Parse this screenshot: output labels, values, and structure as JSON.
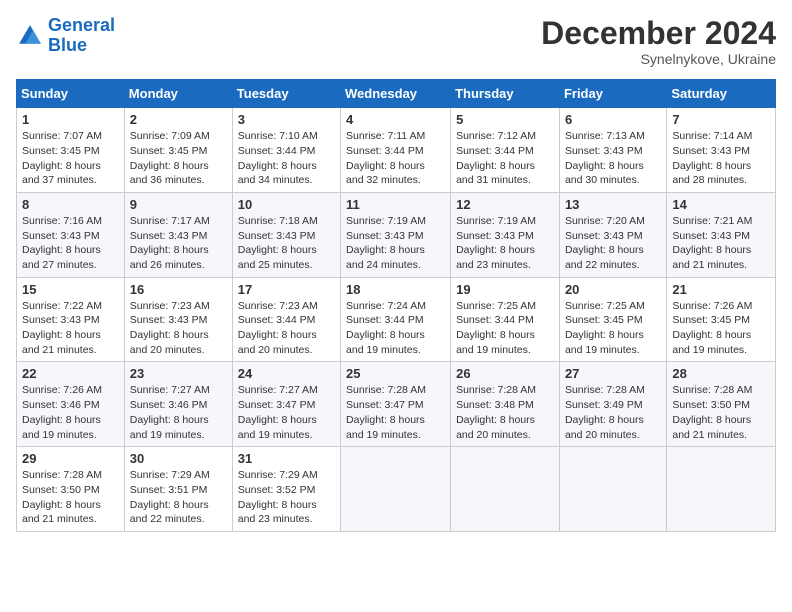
{
  "logo": {
    "line1": "General",
    "line2": "Blue"
  },
  "title": "December 2024",
  "subtitle": "Synelnykove, Ukraine",
  "days_header": [
    "Sunday",
    "Monday",
    "Tuesday",
    "Wednesday",
    "Thursday",
    "Friday",
    "Saturday"
  ],
  "weeks": [
    [
      {
        "day": "1",
        "rise": "Sunrise: 7:07 AM",
        "set": "Sunset: 3:45 PM",
        "daylight": "Daylight: 8 hours and 37 minutes."
      },
      {
        "day": "2",
        "rise": "Sunrise: 7:09 AM",
        "set": "Sunset: 3:45 PM",
        "daylight": "Daylight: 8 hours and 36 minutes."
      },
      {
        "day": "3",
        "rise": "Sunrise: 7:10 AM",
        "set": "Sunset: 3:44 PM",
        "daylight": "Daylight: 8 hours and 34 minutes."
      },
      {
        "day": "4",
        "rise": "Sunrise: 7:11 AM",
        "set": "Sunset: 3:44 PM",
        "daylight": "Daylight: 8 hours and 32 minutes."
      },
      {
        "day": "5",
        "rise": "Sunrise: 7:12 AM",
        "set": "Sunset: 3:44 PM",
        "daylight": "Daylight: 8 hours and 31 minutes."
      },
      {
        "day": "6",
        "rise": "Sunrise: 7:13 AM",
        "set": "Sunset: 3:43 PM",
        "daylight": "Daylight: 8 hours and 30 minutes."
      },
      {
        "day": "7",
        "rise": "Sunrise: 7:14 AM",
        "set": "Sunset: 3:43 PM",
        "daylight": "Daylight: 8 hours and 28 minutes."
      }
    ],
    [
      {
        "day": "8",
        "rise": "Sunrise: 7:16 AM",
        "set": "Sunset: 3:43 PM",
        "daylight": "Daylight: 8 hours and 27 minutes."
      },
      {
        "day": "9",
        "rise": "Sunrise: 7:17 AM",
        "set": "Sunset: 3:43 PM",
        "daylight": "Daylight: 8 hours and 26 minutes."
      },
      {
        "day": "10",
        "rise": "Sunrise: 7:18 AM",
        "set": "Sunset: 3:43 PM",
        "daylight": "Daylight: 8 hours and 25 minutes."
      },
      {
        "day": "11",
        "rise": "Sunrise: 7:19 AM",
        "set": "Sunset: 3:43 PM",
        "daylight": "Daylight: 8 hours and 24 minutes."
      },
      {
        "day": "12",
        "rise": "Sunrise: 7:19 AM",
        "set": "Sunset: 3:43 PM",
        "daylight": "Daylight: 8 hours and 23 minutes."
      },
      {
        "day": "13",
        "rise": "Sunrise: 7:20 AM",
        "set": "Sunset: 3:43 PM",
        "daylight": "Daylight: 8 hours and 22 minutes."
      },
      {
        "day": "14",
        "rise": "Sunrise: 7:21 AM",
        "set": "Sunset: 3:43 PM",
        "daylight": "Daylight: 8 hours and 21 minutes."
      }
    ],
    [
      {
        "day": "15",
        "rise": "Sunrise: 7:22 AM",
        "set": "Sunset: 3:43 PM",
        "daylight": "Daylight: 8 hours and 21 minutes."
      },
      {
        "day": "16",
        "rise": "Sunrise: 7:23 AM",
        "set": "Sunset: 3:43 PM",
        "daylight": "Daylight: 8 hours and 20 minutes."
      },
      {
        "day": "17",
        "rise": "Sunrise: 7:23 AM",
        "set": "Sunset: 3:44 PM",
        "daylight": "Daylight: 8 hours and 20 minutes."
      },
      {
        "day": "18",
        "rise": "Sunrise: 7:24 AM",
        "set": "Sunset: 3:44 PM",
        "daylight": "Daylight: 8 hours and 19 minutes."
      },
      {
        "day": "19",
        "rise": "Sunrise: 7:25 AM",
        "set": "Sunset: 3:44 PM",
        "daylight": "Daylight: 8 hours and 19 minutes."
      },
      {
        "day": "20",
        "rise": "Sunrise: 7:25 AM",
        "set": "Sunset: 3:45 PM",
        "daylight": "Daylight: 8 hours and 19 minutes."
      },
      {
        "day": "21",
        "rise": "Sunrise: 7:26 AM",
        "set": "Sunset: 3:45 PM",
        "daylight": "Daylight: 8 hours and 19 minutes."
      }
    ],
    [
      {
        "day": "22",
        "rise": "Sunrise: 7:26 AM",
        "set": "Sunset: 3:46 PM",
        "daylight": "Daylight: 8 hours and 19 minutes."
      },
      {
        "day": "23",
        "rise": "Sunrise: 7:27 AM",
        "set": "Sunset: 3:46 PM",
        "daylight": "Daylight: 8 hours and 19 minutes."
      },
      {
        "day": "24",
        "rise": "Sunrise: 7:27 AM",
        "set": "Sunset: 3:47 PM",
        "daylight": "Daylight: 8 hours and 19 minutes."
      },
      {
        "day": "25",
        "rise": "Sunrise: 7:28 AM",
        "set": "Sunset: 3:47 PM",
        "daylight": "Daylight: 8 hours and 19 minutes."
      },
      {
        "day": "26",
        "rise": "Sunrise: 7:28 AM",
        "set": "Sunset: 3:48 PM",
        "daylight": "Daylight: 8 hours and 20 minutes."
      },
      {
        "day": "27",
        "rise": "Sunrise: 7:28 AM",
        "set": "Sunset: 3:49 PM",
        "daylight": "Daylight: 8 hours and 20 minutes."
      },
      {
        "day": "28",
        "rise": "Sunrise: 7:28 AM",
        "set": "Sunset: 3:50 PM",
        "daylight": "Daylight: 8 hours and 21 minutes."
      }
    ],
    [
      {
        "day": "29",
        "rise": "Sunrise: 7:28 AM",
        "set": "Sunset: 3:50 PM",
        "daylight": "Daylight: 8 hours and 21 minutes."
      },
      {
        "day": "30",
        "rise": "Sunrise: 7:29 AM",
        "set": "Sunset: 3:51 PM",
        "daylight": "Daylight: 8 hours and 22 minutes."
      },
      {
        "day": "31",
        "rise": "Sunrise: 7:29 AM",
        "set": "Sunset: 3:52 PM",
        "daylight": "Daylight: 8 hours and 23 minutes."
      },
      null,
      null,
      null,
      null
    ]
  ]
}
